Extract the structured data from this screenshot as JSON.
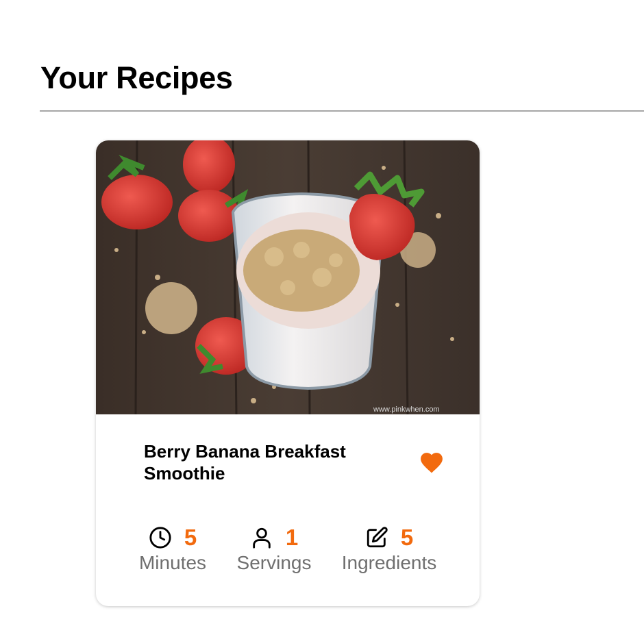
{
  "page": {
    "title": "Your Recipes"
  },
  "recipe_card": {
    "title": "Berry Banana Breakfast Smoothie",
    "favorite": true,
    "image": {
      "watermark": "www.pinkwhen.com"
    },
    "stats": {
      "minutes": {
        "value": "5",
        "label": "Minutes",
        "icon": "clock-icon"
      },
      "servings": {
        "value": "1",
        "label": "Servings",
        "icon": "person-icon"
      },
      "ingredients": {
        "value": "5",
        "label": "Ingredients",
        "icon": "edit-icon"
      }
    }
  },
  "colors": {
    "accent": "#f26a0e",
    "label_gray": "#6f6f6f",
    "divider": "#a6a6a6"
  }
}
